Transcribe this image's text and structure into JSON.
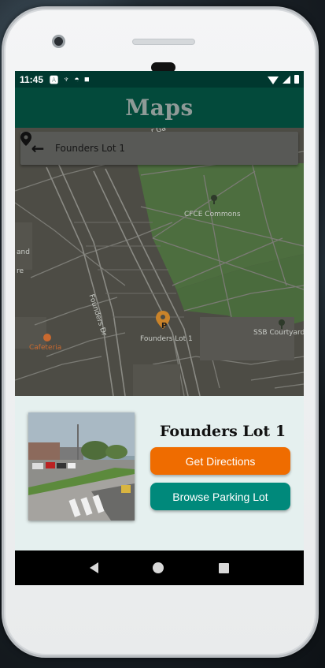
{
  "status_bar": {
    "time": "11:45",
    "left_icons": [
      "a-icon",
      "usb-icon",
      "nfc-icon",
      "sdcard-icon"
    ],
    "right_icons": [
      "wifi-icon",
      "signal-icon",
      "battery-icon"
    ]
  },
  "app_bar": {
    "title": "Maps"
  },
  "search": {
    "value": "Founders Lot 1",
    "back_icon": "arrow-left-icon",
    "location_icon": "map-pin-icon"
  },
  "map": {
    "labels": {
      "cfce": "CFCE Commons",
      "ssb": "SSB Courtyard",
      "founders_dr": "Founders Dr",
      "cafeteria": "Cafeteria",
      "marker": "Founders Lot 1",
      "edge_and": "and",
      "edge_re": "re",
      "road_top": "r Ga"
    },
    "colors": {
      "green": "#4d6e3f",
      "road": "#5f5f5b",
      "base": "#4d4c45",
      "marker": "#c9832a"
    }
  },
  "info": {
    "title": "Founders Lot 1",
    "directions_button": "Get Directions",
    "browse_button": "Browse Parking Lot",
    "directions_color": "#ef6c00",
    "browse_color": "#00897b"
  },
  "nav": {
    "back_icon": "nav-back-icon",
    "home_icon": "nav-home-icon",
    "recents_icon": "nav-recents-icon"
  }
}
